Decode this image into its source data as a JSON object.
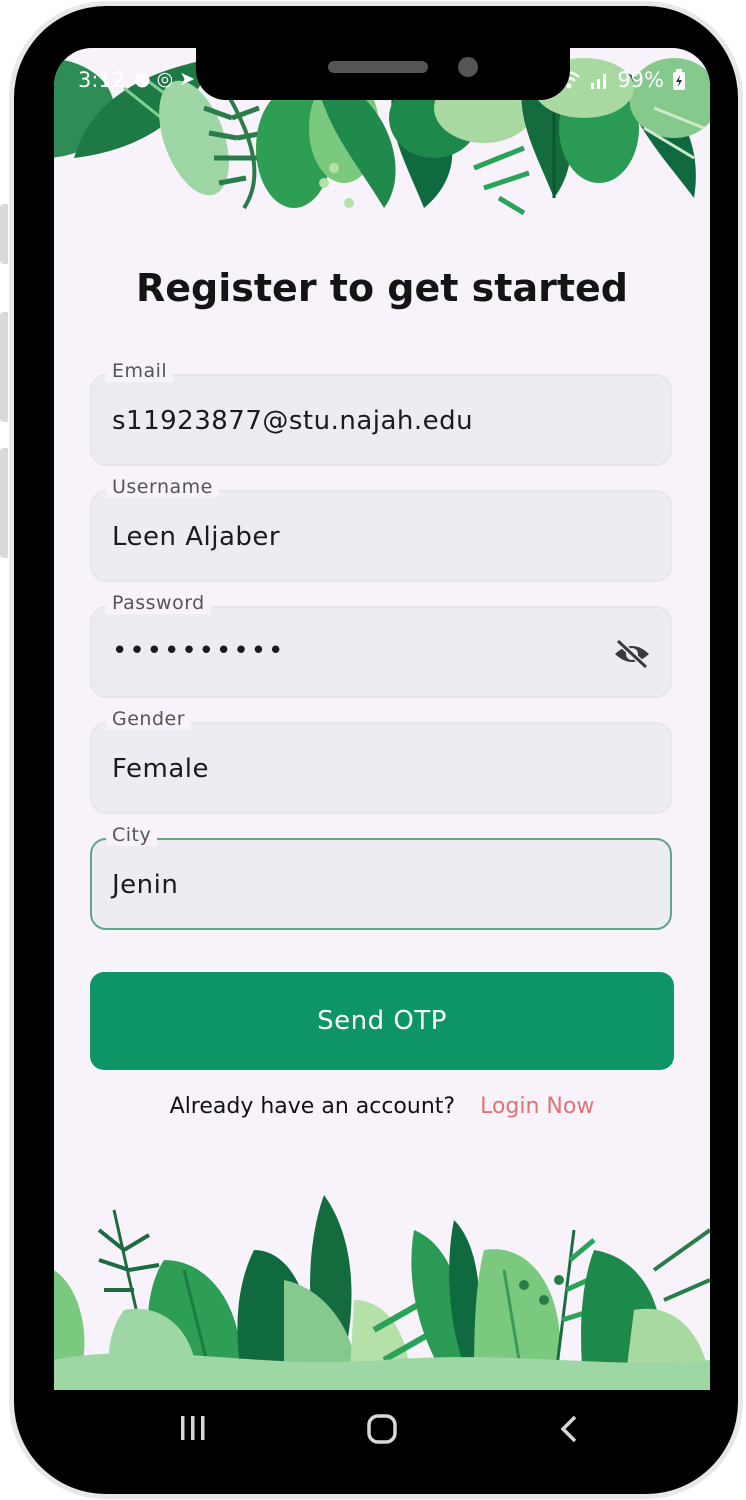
{
  "status_bar": {
    "time": "3:12",
    "battery": "99%",
    "left_icons": [
      "facebook-icon",
      "shield-icon",
      "navigation-icon"
    ],
    "right_icons": [
      "wifi-icon",
      "signal-icon",
      "battery-charging-icon"
    ]
  },
  "page": {
    "title": "Register to get started"
  },
  "form": {
    "email": {
      "label": "Email",
      "value": "s11923877@stu.najah.edu"
    },
    "username": {
      "label": "Username",
      "value": "Leen Aljaber"
    },
    "password": {
      "label": "Password",
      "value": "••••••••••",
      "toggle_icon": "eye-slash-icon"
    },
    "gender": {
      "label": "Gender",
      "value": "Female"
    },
    "city": {
      "label": "City",
      "value": "Jenin"
    }
  },
  "actions": {
    "send_otp_label": "Send OTP",
    "account_prompt": "Already have an account?",
    "login_label": "Login Now"
  },
  "colors": {
    "primary": "#0d9566",
    "link": "#e07474",
    "background": "#f8f3fa",
    "field_background": "#eeecf3",
    "focus_border": "#5fa58a"
  },
  "nav_bar": {
    "icons": [
      "recent-apps-icon",
      "home-icon",
      "back-icon"
    ]
  }
}
